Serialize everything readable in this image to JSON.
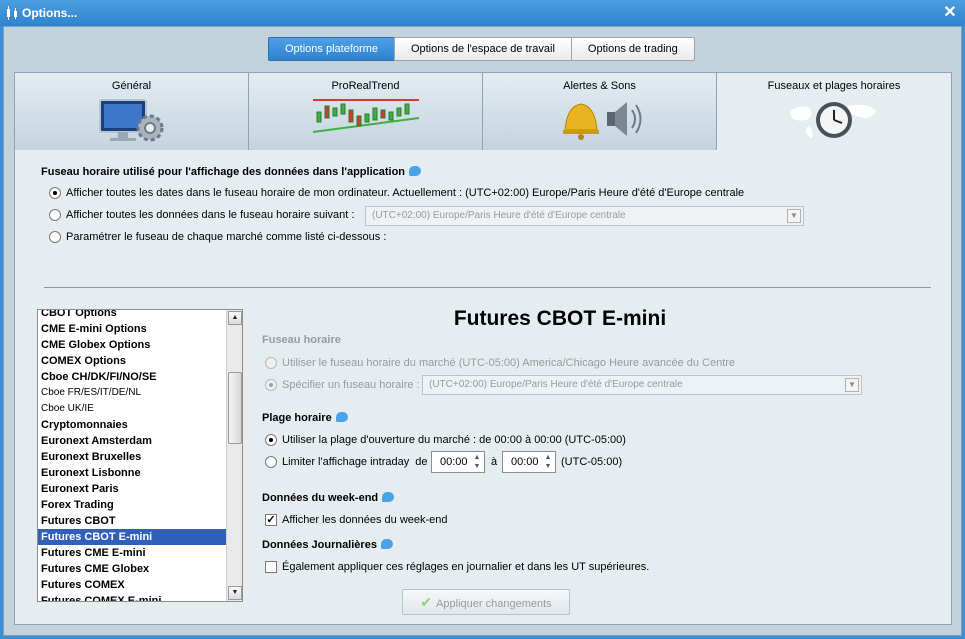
{
  "window": {
    "title": "Options...",
    "close": "✕"
  },
  "top_tabs": [
    {
      "label": "Options plateforme",
      "active": true
    },
    {
      "label": "Options de l'espace de travail",
      "active": false
    },
    {
      "label": "Options de trading",
      "active": false
    }
  ],
  "category_tabs": [
    {
      "label": "Général",
      "icon": "monitor-gear-icon"
    },
    {
      "label": "ProRealTrend",
      "icon": "trend-chart-icon"
    },
    {
      "label": "Alertes & Sons",
      "icon": "bell-speaker-icon"
    },
    {
      "label": "Fuseaux et plages horaires",
      "icon": "world-clock-icon",
      "active": true
    }
  ],
  "timezone_section": {
    "title": "Fuseau horaire utilisé pour l'affichage des données dans l'application",
    "option1": "Afficher toutes les dates dans le fuseau horaire de mon ordinateur. Actuellement : (UTC+02:00) Europe/Paris Heure d'été d'Europe centrale",
    "option2": "Afficher toutes les données dans le fuseau horaire suivant :",
    "option2_combo": "(UTC+02:00) Europe/Paris Heure d'été d'Europe centrale",
    "option3": "Paramétrer le fuseau de chaque marché comme listé ci-dessous :",
    "selected": 1
  },
  "market_list": [
    {
      "label": "CBOT Options",
      "bold": true
    },
    {
      "label": "CME E-mini Options",
      "bold": true
    },
    {
      "label": "CME Globex Options",
      "bold": true
    },
    {
      "label": "COMEX Options",
      "bold": true
    },
    {
      "label": "Cboe CH/DK/FI/NO/SE",
      "bold": true
    },
    {
      "label": "Cboe FR/ES/IT/DE/NL",
      "bold": false
    },
    {
      "label": "Cboe UK/IE",
      "bold": false
    },
    {
      "label": "Cryptomonnaies",
      "bold": true
    },
    {
      "label": "Euronext Amsterdam",
      "bold": true
    },
    {
      "label": "Euronext Bruxelles",
      "bold": true
    },
    {
      "label": "Euronext Lisbonne",
      "bold": true
    },
    {
      "label": "Euronext Paris",
      "bold": true
    },
    {
      "label": "Forex Trading",
      "bold": true
    },
    {
      "label": "Futures CBOT",
      "bold": true
    },
    {
      "label": "Futures CBOT E-mini",
      "bold": true,
      "selected": true
    },
    {
      "label": "Futures CME E-mini",
      "bold": true
    },
    {
      "label": "Futures CME Globex",
      "bold": true
    },
    {
      "label": "Futures COMEX",
      "bold": true
    },
    {
      "label": "Futures COMEX E-mini",
      "bold": true
    }
  ],
  "detail": {
    "title": "Futures CBOT E-mini",
    "fuseau": {
      "title": "Fuseau horaire",
      "opt_market": "Utiliser le fuseau horaire du marché (UTC-05:00) America/Chicago Heure avancée du Centre",
      "opt_specify": "Spécifier un fuseau horaire :",
      "combo": "(UTC+02:00) Europe/Paris Heure d'été d'Europe centrale"
    },
    "plage": {
      "title": "Plage horaire",
      "opt_open": "Utiliser la plage d'ouverture du marché : de 00:00 à 00:00  (UTC-05:00)",
      "opt_limit": "Limiter l'affichage intraday",
      "de": "de",
      "from": "00:00",
      "a": "à",
      "to": "00:00",
      "tz": "(UTC-05:00)"
    },
    "weekend": {
      "title": "Données du week-end",
      "check_label": "Afficher les données du week-end",
      "checked": true
    },
    "journal": {
      "title": "Données Journalières",
      "check_label": "Également appliquer ces réglages en journalier et dans les UT supérieures.",
      "checked": false
    }
  },
  "apply_button": "Appliquer changements"
}
